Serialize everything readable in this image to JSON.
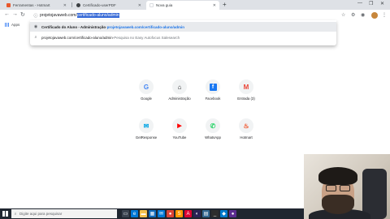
{
  "tabs": [
    {
      "label": "Ferramentas - Hotmart",
      "favicon_color": "#e8572b"
    },
    {
      "label": "Certificado-userPDF",
      "favicon_color": "#3c4043"
    },
    {
      "label": "Nova guia",
      "favicon_color": "#ffffff"
    }
  ],
  "toolbar": {
    "url_prefix": "projetojavaweb.com/",
    "url_selected": "certificado-aluno/admin"
  },
  "bookmarks": {
    "apps_label": "Apps"
  },
  "suggestions": [
    {
      "title": "Certificado do Aluno - Administração",
      "sep": " - ",
      "url": "projetojavaweb.com/certificado-aluno/admin"
    },
    {
      "url": "projetojavaweb.com/certificado-aluno/admin",
      "sep": " - ",
      "hint": "Pesquisa no Easy Autofocus Salesearch"
    }
  ],
  "shortcuts": [
    {
      "label": "Google",
      "glyph": "G",
      "color": "#4285f4"
    },
    {
      "label": "Administração",
      "glyph": "⌂",
      "color": "#202124"
    },
    {
      "label": "Facebook",
      "glyph": "f",
      "color": "#1877f2"
    },
    {
      "label": "Entrada (3)",
      "glyph": "M",
      "color": "#ea4335"
    },
    {
      "label": "GetResponse",
      "glyph": "✉",
      "color": "#00a4e4"
    },
    {
      "label": "YouTube",
      "glyph": "▶",
      "color": "#ff0000"
    },
    {
      "label": "WhatsApp",
      "glyph": "✆",
      "color": "#25d366"
    },
    {
      "label": "Hotmart",
      "glyph": "♨",
      "color": "#f04e23"
    }
  ],
  "taskbar": {
    "search_placeholder": "Digite aqui para pesquisar",
    "apps": [
      {
        "name": "task-view",
        "color": "#3a4350",
        "glyph": "▭"
      },
      {
        "name": "edge",
        "color": "#0078d7",
        "glyph": "e"
      },
      {
        "name": "file-explorer",
        "color": "#f2c14e",
        "glyph": "▬"
      },
      {
        "name": "store",
        "color": "#0f6cbd",
        "glyph": "▦"
      },
      {
        "name": "mail",
        "color": "#0078d4",
        "glyph": "✉"
      },
      {
        "name": "chrome",
        "color": "#db4437",
        "glyph": "●"
      },
      {
        "name": "sublime",
        "color": "#ff9800",
        "glyph": "S"
      },
      {
        "name": "angular",
        "color": "#dd0031",
        "glyph": "A"
      },
      {
        "name": "eclipse",
        "color": "#2c2255",
        "glyph": "◐"
      },
      {
        "name": "database",
        "color": "#336791",
        "glyph": "▤"
      },
      {
        "name": "terminal",
        "color": "#2d2d2d",
        "glyph": "_"
      },
      {
        "name": "vscode",
        "color": "#007acc",
        "glyph": "◆"
      },
      {
        "name": "camera",
        "color": "#5c2d91",
        "glyph": "●"
      }
    ]
  },
  "colors": {
    "selection": "#3367d6",
    "link": "#1a73e8",
    "taskbar": "#1f2630"
  }
}
